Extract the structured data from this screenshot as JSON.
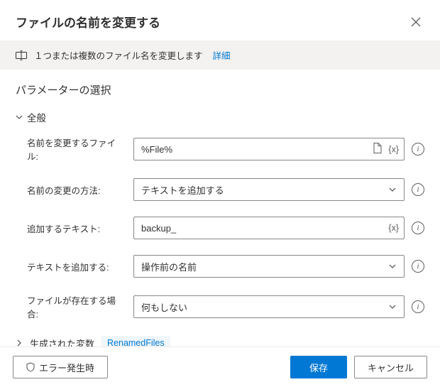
{
  "header": {
    "title": "ファイルの名前を変更する"
  },
  "info": {
    "text": "１つまたは複数のファイル名を変更します",
    "link": "詳細"
  },
  "section": {
    "title": "パラメーターの選択",
    "group_general": "全般"
  },
  "params": {
    "file_to_rename": {
      "label": "名前を変更するファイル:",
      "value": "%File%"
    },
    "rename_method": {
      "label": "名前の変更の方法:",
      "value": "テキストを追加する"
    },
    "text_to_add": {
      "label": "追加するテキスト:",
      "value": "backup_"
    },
    "add_text_pos": {
      "label": "テキストを追加する:",
      "value": "操作前の名前"
    },
    "if_exists": {
      "label": "ファイルが存在する場合:",
      "value": "何もしない"
    }
  },
  "generated": {
    "label": "生成された変数",
    "var": "RenamedFiles"
  },
  "footer": {
    "on_error": "エラー発生時",
    "save": "保存",
    "cancel": "キャンセル"
  }
}
